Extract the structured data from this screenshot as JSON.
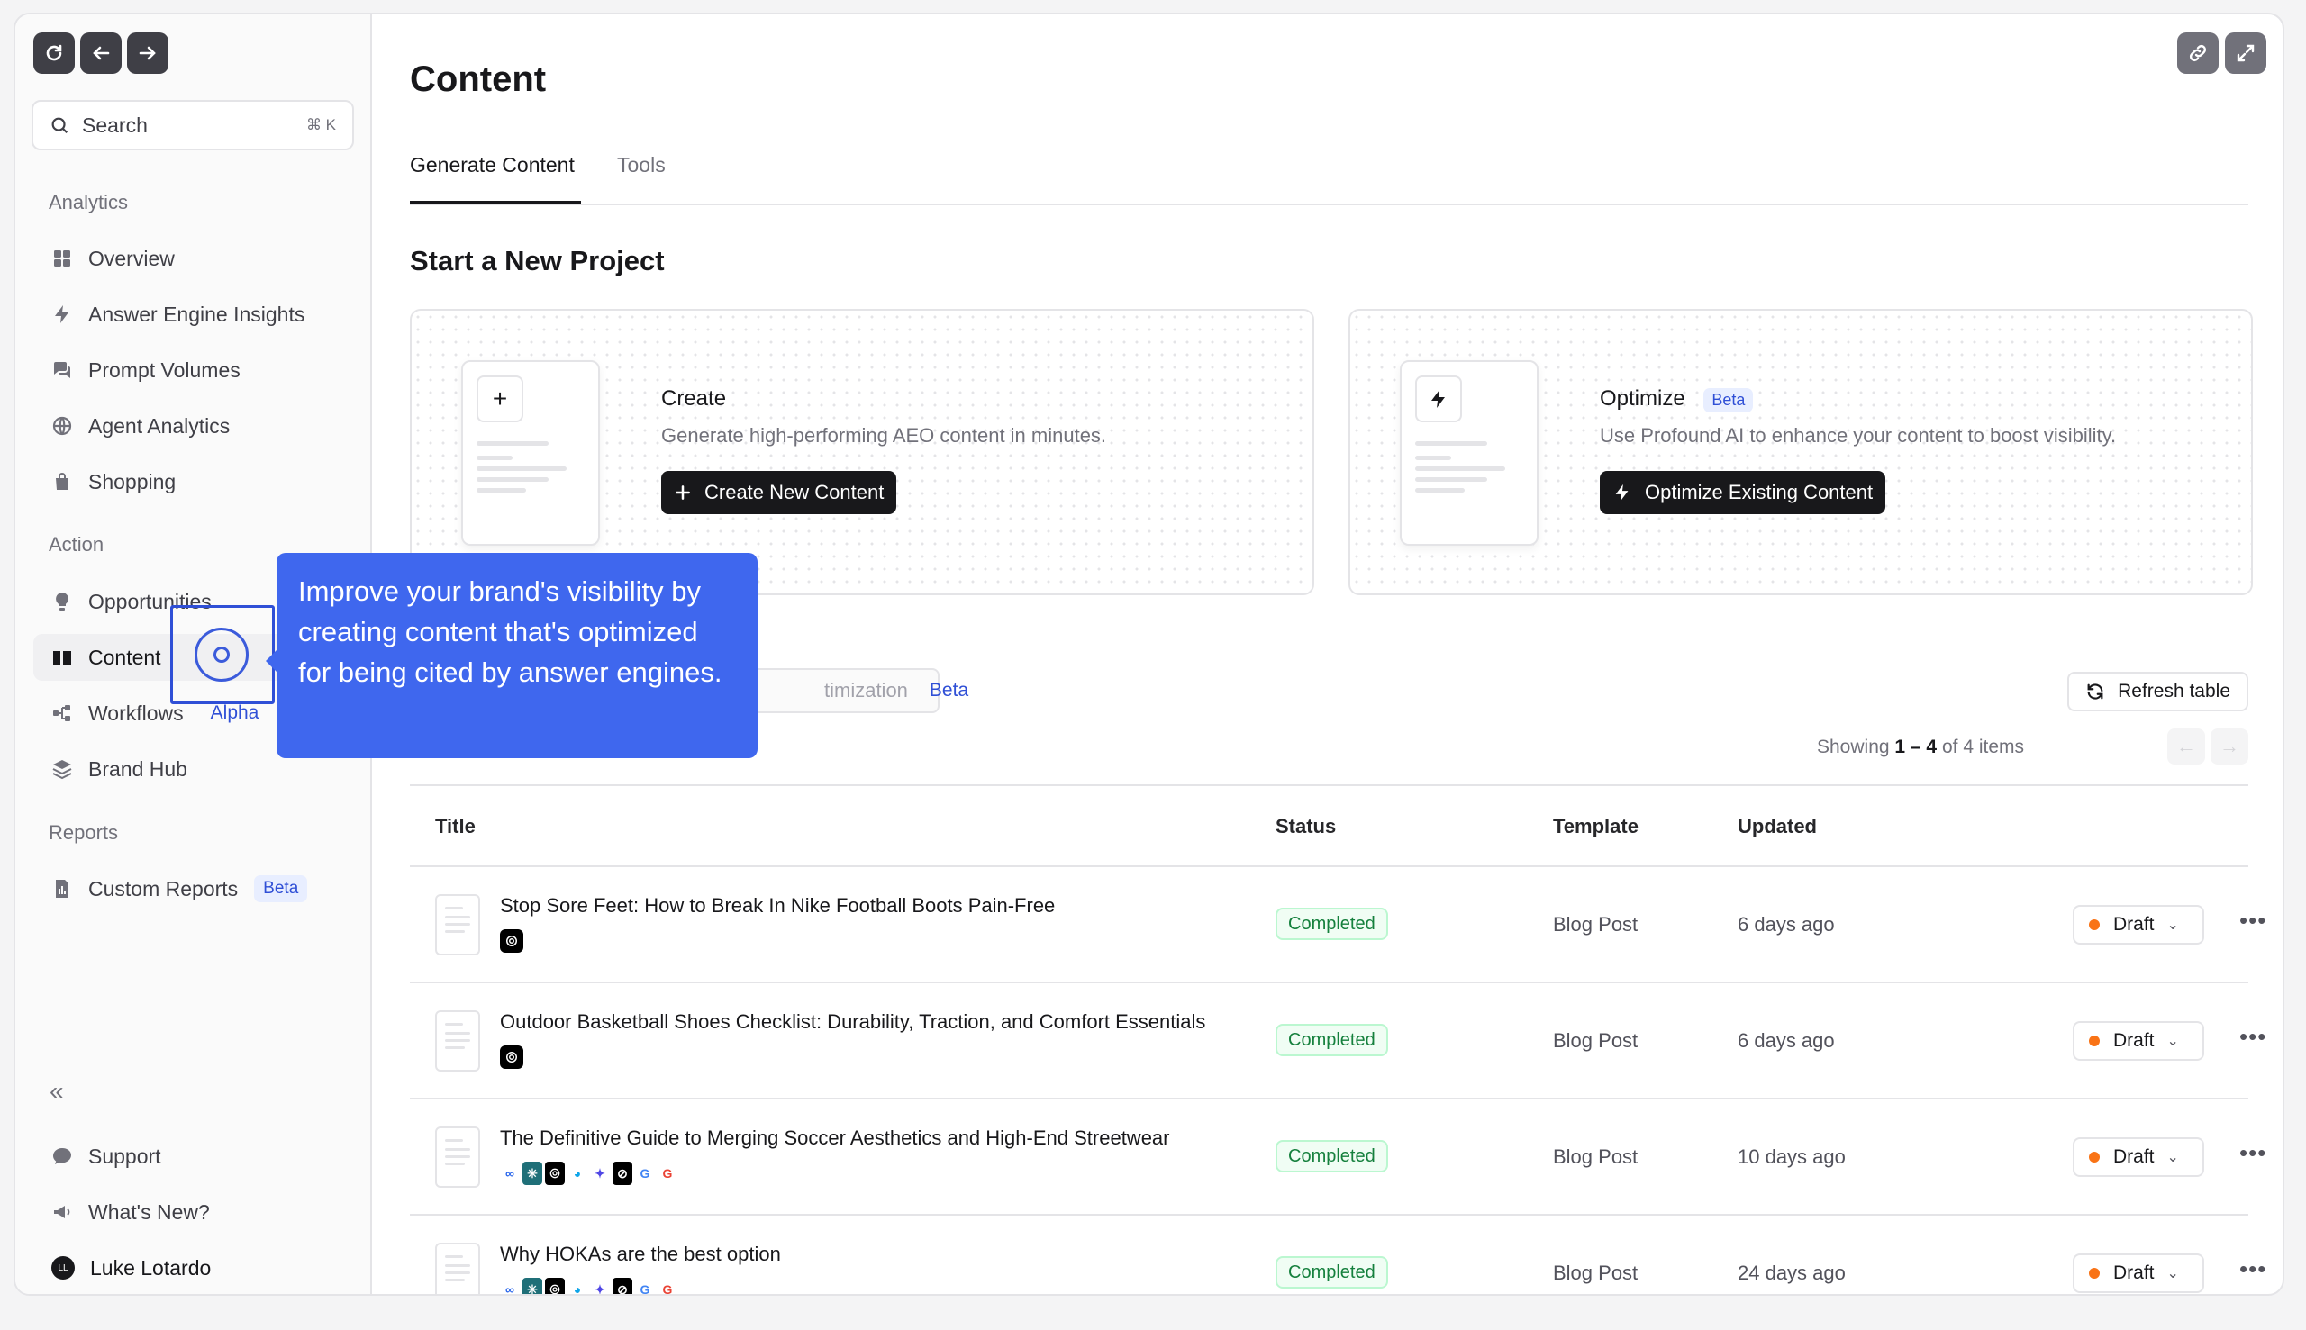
{
  "sidebar": {
    "search_label": "Search",
    "search_shortcut": "⌘ K",
    "sections": {
      "analytics": "Analytics",
      "action": "Action",
      "reports": "Reports"
    },
    "analytics_items": [
      {
        "label": "Overview",
        "icon": "grid-icon"
      },
      {
        "label": "Answer Engine Insights",
        "icon": "bolt-icon"
      },
      {
        "label": "Prompt Volumes",
        "icon": "chat-icon"
      },
      {
        "label": "Agent Analytics",
        "icon": "globe-icon"
      },
      {
        "label": "Shopping",
        "icon": "bag-icon"
      }
    ],
    "action_items": [
      {
        "label": "Opportunities",
        "icon": "bulb-icon"
      },
      {
        "label": "Content",
        "icon": "book-icon"
      },
      {
        "label": "Workflows",
        "icon": "workflow-icon",
        "tag": "Alpha"
      },
      {
        "label": "Brand Hub",
        "icon": "layers-icon"
      }
    ],
    "reports_items": [
      {
        "label": "Custom Reports",
        "icon": "report-icon",
        "badge": "Beta"
      }
    ],
    "collapse_label": "«",
    "footer": {
      "support": "Support",
      "whats_new": "What's New?",
      "user_name": "Luke Lotardo",
      "user_initials": "LL"
    }
  },
  "main": {
    "title": "Content",
    "tabs": [
      "Generate Content",
      "Tools"
    ],
    "section_title": "Start a New Project",
    "cards": [
      {
        "title": "Create",
        "description": "Generate high-performing AEO content in minutes.",
        "button": "Create New Content",
        "icon_glyph": "+"
      },
      {
        "title": "Optimize",
        "badge": "Beta",
        "description": "Use Profound AI to enhance your content to boost visibility.",
        "button": "Optimize Existing Content"
      }
    ],
    "filter_chip": {
      "label": "timization",
      "badge": "Beta"
    },
    "refresh_label": "Refresh table",
    "showing": {
      "prefix": "Showing",
      "range": "1 – 4",
      "of": "of 4 items"
    },
    "table": {
      "headers": [
        "Title",
        "Status",
        "Template",
        "Updated"
      ],
      "rows": [
        {
          "title": "Stop Sore Feet: How to Break In Nike Football Boots Pain-Free",
          "status": "Completed",
          "template": "Blog Post",
          "updated": "6 days ago",
          "draft": "Draft",
          "engines": [
            "openai"
          ]
        },
        {
          "title": "Outdoor Basketball Shoes Checklist: Durability, Traction, and Comfort Essentials",
          "status": "Completed",
          "template": "Blog Post",
          "updated": "6 days ago",
          "draft": "Draft",
          "engines": [
            "openai"
          ]
        },
        {
          "title": "The Definitive Guide to Merging Soccer Aesthetics and High-End Streetwear",
          "status": "Completed",
          "template": "Blog Post",
          "updated": "10 days ago",
          "draft": "Draft",
          "engines": [
            "meta",
            "perplexity",
            "openai",
            "copilot",
            "gemini",
            "grok",
            "google",
            "google"
          ]
        },
        {
          "title": "Why HOKAs are the best option",
          "status": "Completed",
          "template": "Blog Post",
          "updated": "24 days ago",
          "draft": "Draft",
          "engines": [
            "meta",
            "perplexity",
            "openai",
            "copilot",
            "gemini",
            "grok",
            "google",
            "google"
          ]
        }
      ]
    }
  },
  "tooltip": {
    "text": "Improve your brand's visibility by creating content that's optimized for being cited by answer engines."
  },
  "colors": {
    "accent": "#3f67ee",
    "status_green": "#15803d",
    "draft_dot": "#f97316"
  }
}
